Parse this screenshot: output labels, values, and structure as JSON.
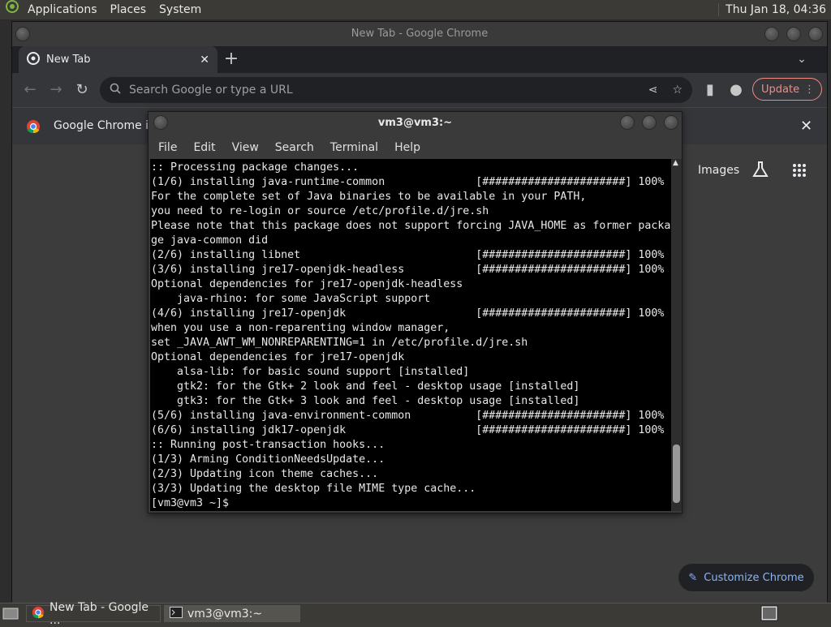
{
  "top_panel": {
    "menus": [
      "Applications",
      "Places",
      "System"
    ],
    "clock": "Thu Jan 18, 04:36"
  },
  "chrome": {
    "title": "New Tab - Google Chrome",
    "tab_label": "New Tab",
    "omnibox_placeholder": "Search Google or type a URL",
    "update_label": "Update",
    "infobar_text": "Google Chrome isn",
    "ntp_links": {
      "images": "Images"
    },
    "customize_label": "Customize Chrome"
  },
  "terminal": {
    "title": "vm3@vm3:~",
    "menu": [
      "File",
      "Edit",
      "View",
      "Search",
      "Terminal",
      "Help"
    ],
    "lines": [
      ":: Processing package changes...",
      "(1/6) installing java-runtime-common              [######################] 100%",
      "For the complete set of Java binaries to be available in your PATH,",
      "you need to re-login or source /etc/profile.d/jre.sh",
      "Please note that this package does not support forcing JAVA_HOME as former packa",
      "ge java-common did",
      "(2/6) installing libnet                           [######################] 100%",
      "(3/6) installing jre17-openjdk-headless           [######################] 100%",
      "Optional dependencies for jre17-openjdk-headless",
      "    java-rhino: for some JavaScript support",
      "(4/6) installing jre17-openjdk                    [######################] 100%",
      "when you use a non-reparenting window manager,",
      "set _JAVA_AWT_WM_NONREPARENTING=1 in /etc/profile.d/jre.sh",
      "Optional dependencies for jre17-openjdk",
      "    alsa-lib: for basic sound support [installed]",
      "    gtk2: for the Gtk+ 2 look and feel - desktop usage [installed]",
      "    gtk3: for the Gtk+ 3 look and feel - desktop usage [installed]",
      "(5/6) installing java-environment-common          [######################] 100%",
      "(6/6) installing jdk17-openjdk                    [######################] 100%",
      ":: Running post-transaction hooks...",
      "(1/3) Arming ConditionNeedsUpdate...",
      "(2/3) Updating icon theme caches...",
      "(3/3) Updating the desktop file MIME type cache...",
      "[vm3@vm3 ~]$ "
    ]
  },
  "taskbar": {
    "items": [
      "New Tab - Google ...",
      "vm3@vm3:~"
    ]
  }
}
